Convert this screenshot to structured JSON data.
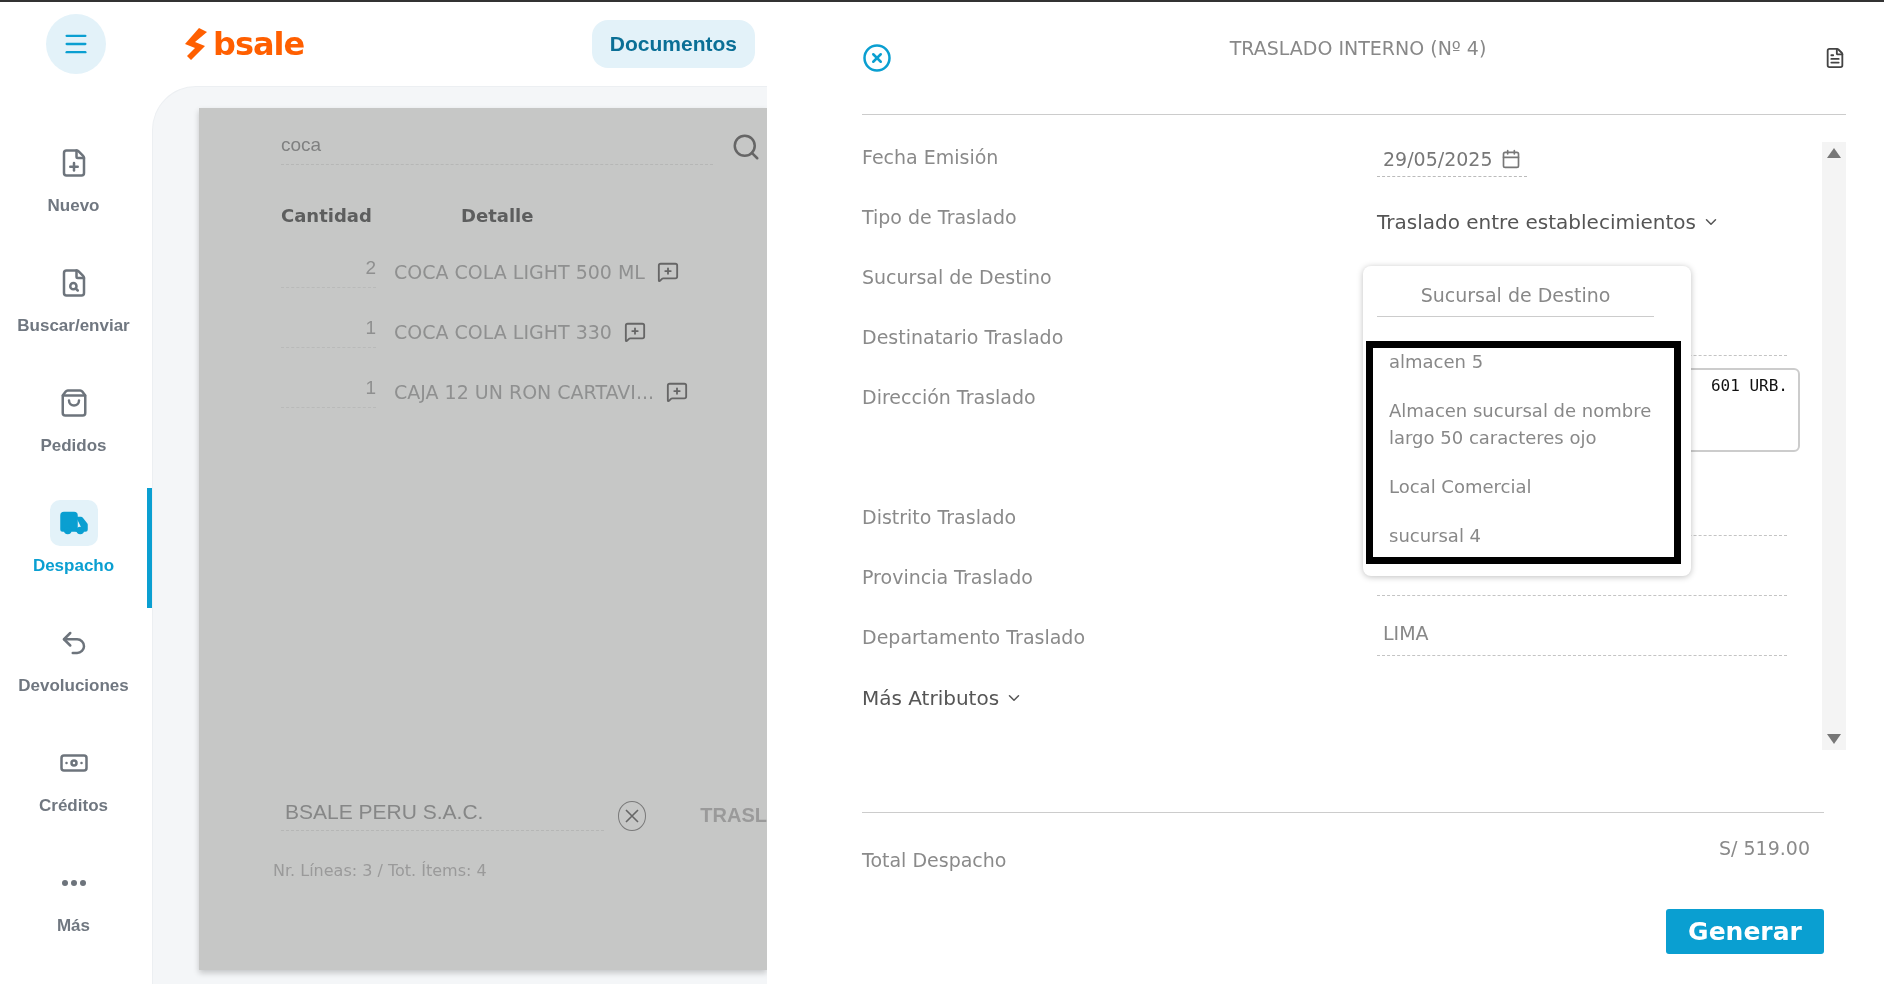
{
  "sidebar": {
    "items": [
      {
        "label": "Nuevo",
        "selected": false
      },
      {
        "label": "Buscar/enviar",
        "selected": false
      },
      {
        "label": "Pedidos",
        "selected": false
      },
      {
        "label": "Despacho",
        "selected": true
      },
      {
        "label": "Devoluciones",
        "selected": false
      },
      {
        "label": "Créditos",
        "selected": false
      },
      {
        "label": "Más",
        "selected": false
      }
    ]
  },
  "header": {
    "logo": "bsale",
    "documents_button": "Documentos"
  },
  "sale": {
    "search": {
      "value": "coca"
    },
    "columns": [
      "Cantidad",
      "Detalle"
    ],
    "rows": [
      {
        "quantity": "2",
        "detail": "COCA COLA LIGHT 500 ML"
      },
      {
        "quantity": "1",
        "detail": "COCA COLA LIGHT 330"
      },
      {
        "quantity": "1",
        "detail": "CAJA 12 UN RON CARTAVI..."
      }
    ],
    "client": "BSALE PERU S.A.C.",
    "document_type": "TRASL",
    "summary": "Nr. Líneas: 3 / Tot. Ítems: 4"
  },
  "panel": {
    "title": "TRASLADO INTERNO (Nº 4)",
    "fields": [
      {
        "label": "Fecha Emisión",
        "kind": "date",
        "value": "29/05/2025"
      },
      {
        "label": "Tipo de Traslado",
        "kind": "select",
        "value": "Traslado entre establecimientos"
      },
      {
        "label": "Sucursal de Destino",
        "kind": "covered"
      },
      {
        "label": "Destinatario Traslado",
        "kind": "text"
      },
      {
        "label": "Dirección Traslado",
        "kind": "textarea",
        "value": "601 URB."
      },
      {
        "label": "Distrito Traslado",
        "kind": "text"
      },
      {
        "label": "Provincia Traslado",
        "kind": "text"
      },
      {
        "label": "Departamento Traslado",
        "kind": "text",
        "value": "LIMA"
      }
    ],
    "more": "Más Atributos",
    "total_label": "Total Despacho",
    "total": "S/ 519.00",
    "submit": "Generar"
  },
  "dropdown": {
    "title": "Sucursal de Destino",
    "options": [
      "almacen 5",
      "Almacen sucursal de nombre largo 50 caracteres ojo",
      "Local Comercial",
      "sucursal 4"
    ]
  }
}
